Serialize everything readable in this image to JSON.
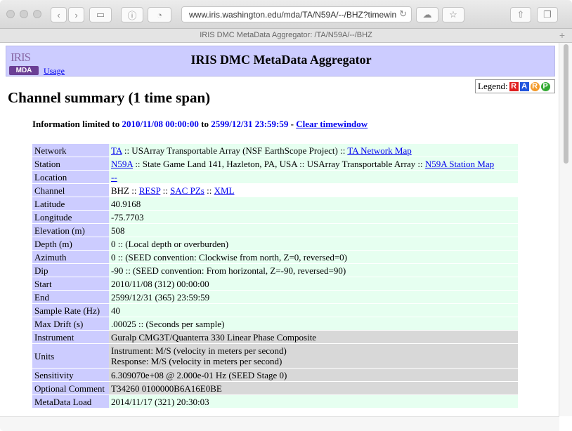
{
  "browser": {
    "url": "www.iris.washington.edu/mda/TA/N59A/--/BHZ?timewin",
    "tab_title": "IRIS DMC MetaData Aggregator: /TA/N59A/--/BHZ"
  },
  "banner": {
    "logo_text": "IRIS",
    "logo_badge": "MDA",
    "usage": "Usage",
    "title": "IRIS DMC MetaData Aggregator"
  },
  "legend": {
    "label": "Legend:",
    "items": [
      "R",
      "A",
      "R",
      "P"
    ],
    "colors": [
      "#e02020",
      "#2255dd",
      "#f39a2a",
      "#33aa33"
    ]
  },
  "heading": "Channel summary (1 time span)",
  "info": {
    "prefix": "Information limited to",
    "start": "2010/11/08 00:00:00",
    "to": "to",
    "end": "2599/12/31 23:59:59",
    "sep": "-",
    "clear": "Clear timewindow"
  },
  "rows": {
    "network": {
      "label": "Network",
      "code": "TA",
      "text": ":: USArray Transportable Array (NSF EarthScope Project) ::",
      "link": "TA Network Map"
    },
    "station": {
      "label": "Station",
      "code": "N59A",
      "text": ":: State Game Land 141, Hazleton, PA, USA :: USArray Transportable Array ::",
      "link": "N59A Station Map"
    },
    "location": {
      "label": "Location",
      "code": "--"
    },
    "channel": {
      "label": "Channel",
      "code": "BHZ",
      "sep": "::",
      "resp": "RESP",
      "sac": "SAC PZs",
      "xml": "XML"
    },
    "latitude": {
      "label": "Latitude",
      "value": "40.9168"
    },
    "longitude": {
      "label": "Longitude",
      "value": "-75.7703"
    },
    "elevation": {
      "label": "Elevation (m)",
      "value": "508"
    },
    "depth": {
      "label": "Depth (m)",
      "value": "0 :: (Local depth or overburden)"
    },
    "azimuth": {
      "label": "Azimuth",
      "value": "0 :: (SEED convention: Clockwise from north, Z=0, reversed=0)"
    },
    "dip": {
      "label": "Dip",
      "value": "-90 :: (SEED convention: From horizontal, Z=-90, reversed=90)"
    },
    "start": {
      "label": "Start",
      "value": "2010/11/08 (312) 00:00:00"
    },
    "end": {
      "label": "End",
      "value": "2599/12/31 (365) 23:59:59"
    },
    "sample_rate": {
      "label": "Sample Rate (Hz)",
      "value": "40"
    },
    "max_drift": {
      "label": "Max Drift (s)",
      "value": ".00025 :: (Seconds per sample)"
    },
    "instrument": {
      "label": "Instrument",
      "value": "Guralp CMG3T/Quanterra 330 Linear Phase Composite"
    },
    "units": {
      "label": "Units",
      "line1": "Instrument: M/S (velocity in meters per second)",
      "line2": "Response: M/S (velocity in meters per second)"
    },
    "sensitivity": {
      "label": "Sensitivity",
      "value": "6.309070e+08 @ 2.000e-01 Hz (SEED Stage 0)"
    },
    "optional_comment": {
      "label": "Optional Comment",
      "value": "T34260 0100000B6A16E0BE"
    },
    "metadata_load": {
      "label": "MetaData Load",
      "value": "2014/11/17 (321) 20:30:03"
    }
  }
}
